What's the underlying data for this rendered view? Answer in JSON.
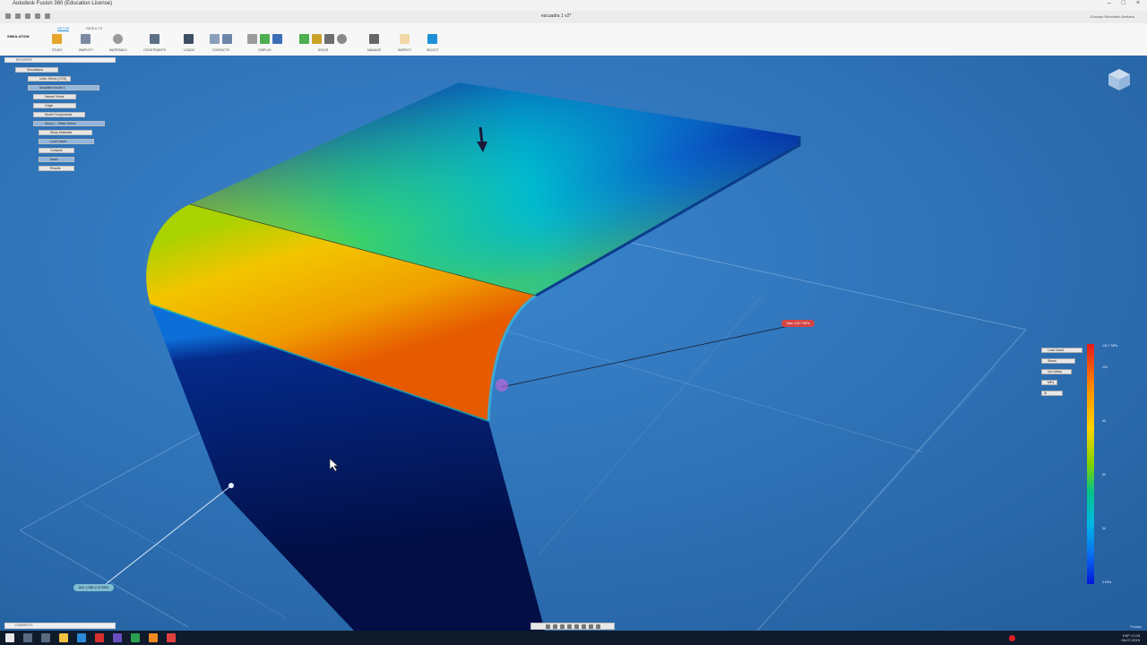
{
  "app": {
    "window_title": "Autodesk Fusion 360 (Education License)",
    "document_tab": "escuadra 1 v2*",
    "user_name": "Gonzalo Rebolledo Arellano"
  },
  "ribbon": {
    "workspace_label": "SIMULATION",
    "tabs": [
      {
        "label": "SETUP",
        "active": true
      },
      {
        "label": "RESULTS",
        "active": false
      }
    ],
    "groups": [
      {
        "label": "STUDY",
        "icons": [
          "study-icon"
        ]
      },
      {
        "label": "SIMPLIFY",
        "icons": [
          "simplify-icon"
        ]
      },
      {
        "label": "MATERIALS",
        "icons": [
          "materials-icon"
        ]
      },
      {
        "label": "CONSTRAINTS",
        "icons": [
          "constraints-icon"
        ]
      },
      {
        "label": "LOADS",
        "icons": [
          "loads-icon"
        ]
      },
      {
        "label": "CONTACTS",
        "icons": [
          "contacts-icon",
          "contacts-manager-icon"
        ]
      },
      {
        "label": "DISPLAY",
        "icons": [
          "display-icon",
          "display-mesh-icon",
          "display-dof-icon"
        ]
      },
      {
        "label": "SOLVE",
        "icons": [
          "pre-check-icon",
          "solve-icon",
          "mesh-icon",
          "solve-settings-icon"
        ]
      },
      {
        "label": "MANAGE",
        "icons": [
          "manage-icon"
        ]
      },
      {
        "label": "INSPECT",
        "icons": [
          "inspect-icon"
        ]
      },
      {
        "label": "SELECT",
        "icons": [
          "select-icon"
        ]
      }
    ]
  },
  "browser": {
    "header": "BROWSER",
    "nodes": [
      {
        "label": "Simulations",
        "level": 0,
        "selected": false
      },
      {
        "label": "Units: Metric (CGS)",
        "level": 1,
        "selected": false
      },
      {
        "label": "Simplified Model 1",
        "level": 1,
        "selected": true
      },
      {
        "label": "Named Views",
        "level": 2,
        "selected": false
      },
      {
        "label": "Origin",
        "level": 2,
        "selected": false
      },
      {
        "label": "Model Components",
        "level": 2,
        "selected": false
      },
      {
        "label": "Study 1 - Static Stress",
        "level": 2,
        "selected": true
      },
      {
        "label": "Study Materials",
        "level": 3,
        "selected": false
      },
      {
        "label": "Load Case1",
        "level": 3,
        "selected": true
      },
      {
        "label": "Contacts",
        "level": 3,
        "selected": false
      },
      {
        "label": "Mesh",
        "level": 3,
        "selected": true
      },
      {
        "label": "Results",
        "level": 3,
        "selected": false
      }
    ]
  },
  "probes": {
    "max_label": "Max: 132.7 MPa",
    "min_label": "Min: 1.96E-2.47 MPa"
  },
  "legend": {
    "load_case": "Load Case1",
    "result_type": "Stress",
    "component": "Von Mises",
    "unit": "MPa",
    "max_text": "132.7 MPa",
    "min_text": "0 MPa",
    "ticks": [
      "120",
      "90",
      "60",
      "30"
    ],
    "gradient_colors": [
      "#e31a1c",
      "#ff8c00",
      "#ffd400",
      "#7fd300",
      "#00c38a",
      "#00b8e6",
      "#0a6cf0",
      "#0016d9"
    ]
  },
  "comments_bar": "COMMENTS",
  "watermark": "Probes",
  "taskbar": {
    "lang": "ESP",
    "time": "17:03",
    "date": "06-07-2019"
  },
  "colors": {
    "viewport_bg": "#2a6fb8",
    "accent": "#1f8fd6",
    "max_probe": "#d64545"
  }
}
